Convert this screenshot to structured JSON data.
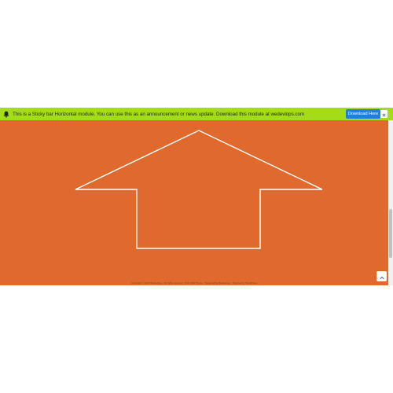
{
  "sticky_bar": {
    "message": "This is a Sticky bar Horizontal module. You can use this as an announcement or news update. Download this module at wedevlops.com",
    "download_label": "Download Here",
    "close_label": "x",
    "icon": "bell-icon"
  },
  "footer": {
    "text": "Copyright © 2018 Wedevlops · All rights reserved · Divi Child Theme · Designed by Wedevlops · Powered by WordPress"
  },
  "colors": {
    "bar_background": "#a4dc1a",
    "hero_background": "#e06a2e",
    "arrow_outline": "#ffffff",
    "button_background": "#1e7fe0"
  },
  "icons": {
    "back_to_top": "chevron-up-icon",
    "close": "close-icon",
    "hero_shape": "up-arrow-outline"
  }
}
